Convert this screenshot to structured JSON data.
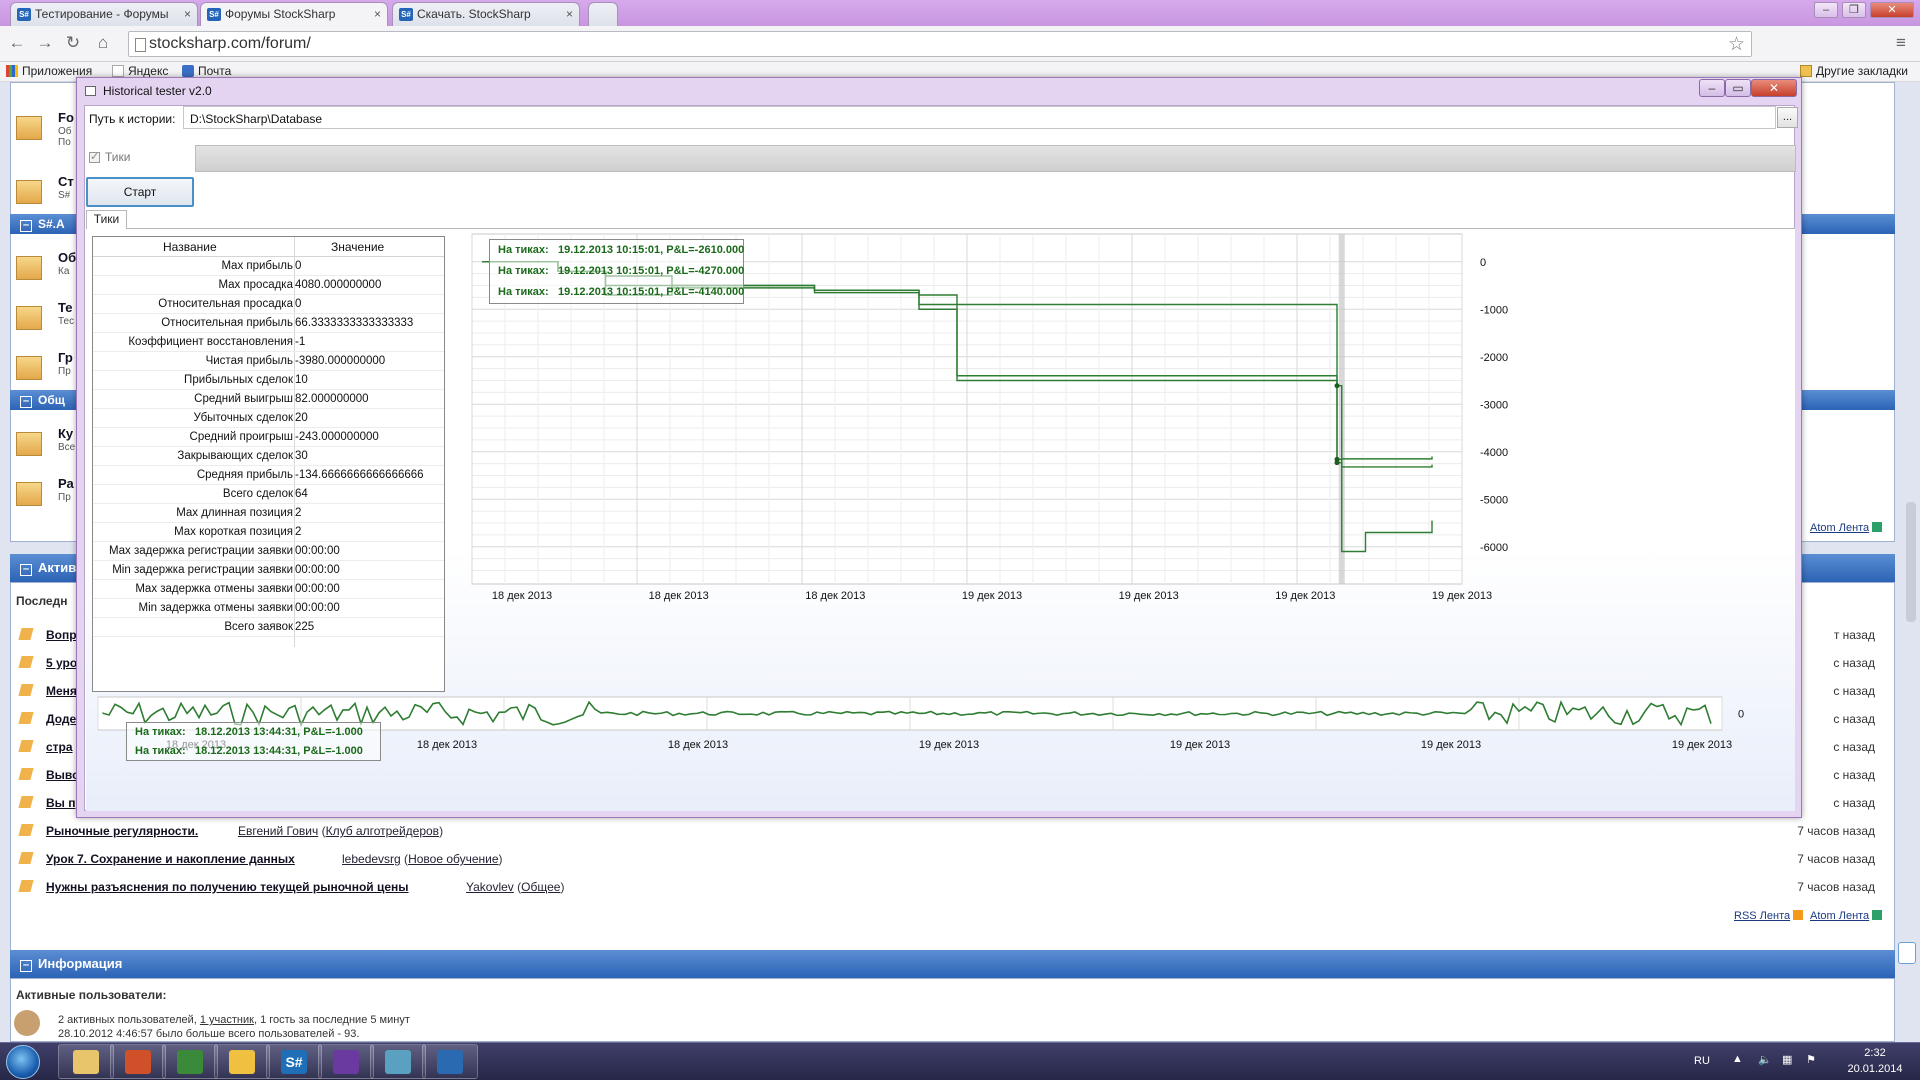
{
  "browser": {
    "tabs": [
      {
        "label": "Тестирование - Форумы"
      },
      {
        "label": "Форумы StockSharp"
      },
      {
        "label": "Скачать. StockSharp"
      }
    ],
    "tab_favicon": "S#",
    "url": "stocksharp.com/forum/",
    "bookmarks": {
      "apps": "Приложения",
      "yandex": "Яндекс",
      "mail": "Почта",
      "other": "Другие закладки"
    }
  },
  "webpage": {
    "left_items": [
      {
        "title": "Fo",
        "desc": "Об\nПо"
      },
      {
        "title": "Ст",
        "desc": "S#"
      },
      {
        "title": "Об",
        "desc": "Ка"
      },
      {
        "title": "Те",
        "desc": "Тес"
      },
      {
        "title": "Гр",
        "desc": "Пр"
      },
      {
        "title": "Ку",
        "desc": "Все"
      },
      {
        "title": "Ра",
        "desc": "Пр"
      }
    ],
    "section_sa": "S#.A",
    "section_general": "Общ",
    "section_active": "Актив",
    "recent_label": "Последн",
    "partial_rows": [
      "Вопр",
      "5 уро",
      "Меня",
      "Доде",
      "стра",
      "Выво",
      "Вы п"
    ],
    "rows": [
      {
        "title": "Рыночные регулярности.",
        "author": "Евгений Гович",
        "forum": "Клуб алготрейдеров",
        "time": "7 часов назад"
      },
      {
        "title": "Урок 7. Сохранение и накопление данных",
        "author": "lebedevsrg",
        "forum": "Новое обучение",
        "time": "7 часов назад"
      },
      {
        "title": "Нужны разъяснения по получению текущей рыночной цены",
        "author": "Yakovlev",
        "forum": "Общее",
        "time": "7 часов назад"
      }
    ],
    "right_times": [
      "т назад",
      "с назад",
      "с назад",
      "с назад",
      "с назад",
      "с назад",
      "с назад",
      "с назад"
    ],
    "rss_link": "RSS Лента",
    "atom_link": "Atom Лента",
    "info_header": "Информация",
    "active_users_label": "Активные пользователи:",
    "active_users_line1_a": "2 активных пользователей, ",
    "active_users_line1_link": "1 участник",
    "active_users_line1_b": ", 1 гость за последние 5 минут",
    "active_users_line2": "28.10.2012 4:46:57 было больше всего пользователей - 93."
  },
  "app": {
    "title": "Historical tester v2.0",
    "path_label": "Путь к истории:",
    "path_value": "D:\\StockSharp\\Database",
    "browse_label": "...",
    "ticks_checkbox": "Тики",
    "start_button": "Старт",
    "tab_label": "Тики",
    "grid_headers": {
      "name": "Название",
      "value": "Значение"
    },
    "stats": [
      {
        "name": "Max прибыль",
        "value": "0"
      },
      {
        "name": "Max просадка",
        "value": "4080.000000000"
      },
      {
        "name": "Относительная просадка",
        "value": "0"
      },
      {
        "name": "Относительная прибыль",
        "value": "66.3333333333333333"
      },
      {
        "name": "Коэффициент восстановления",
        "value": "-1"
      },
      {
        "name": "Чистая прибыль",
        "value": "-3980.000000000"
      },
      {
        "name": "Прибыльных сделок",
        "value": "10"
      },
      {
        "name": "Средний выигрыш",
        "value": "82.000000000"
      },
      {
        "name": "Убыточных сделок",
        "value": "20"
      },
      {
        "name": "Средний проигрыш",
        "value": "-243.000000000"
      },
      {
        "name": "Закрывающих сделок",
        "value": "30"
      },
      {
        "name": "Средняя прибыль",
        "value": "-134.6666666666666666"
      },
      {
        "name": "Всего сделок",
        "value": "64"
      },
      {
        "name": "Max длинная позиция",
        "value": "2"
      },
      {
        "name": "Max короткая позиция",
        "value": "2"
      },
      {
        "name": "Max задержка регистрации заявки",
        "value": "00:00:00"
      },
      {
        "name": "Min задержка регистрации заявки",
        "value": "00:00:00"
      },
      {
        "name": "Max задержка отмены заявки",
        "value": "00:00:00"
      },
      {
        "name": "Min задержка отмены заявки",
        "value": "00:00:00"
      },
      {
        "name": "Всего заявок",
        "value": "225"
      }
    ],
    "main_tooltip": [
      {
        "label": "На тиках:",
        "text": "19.12.2013 10:15:01, P&L=-2610.000"
      },
      {
        "label": "На тиках:",
        "text": "19.12.2013 10:15:01, P&L=-4270.000"
      },
      {
        "label": "На тиках:",
        "text": "19.12.2013 10:15:01, P&L=-4140.000"
      }
    ],
    "small_tooltip": [
      {
        "label": "На тиках:",
        "text": "18.12.2013 13:44:31, P&L=-1.000"
      },
      {
        "label": "На тиках:",
        "text": "18.12.2013 13:44:31, P&L=-1.000"
      }
    ]
  },
  "chart_data": [
    {
      "type": "line",
      "title": "",
      "xlabel": "",
      "ylabel": "",
      "x_ticks": [
        "18 дек 2013",
        "18 дек 2013",
        "18 дек 2013",
        "19 дек 2013",
        "19 дек 2013",
        "19 дек 2013",
        "19 дек 2013"
      ],
      "y_ticks": [
        "0",
        "-1000",
        "-2000",
        "-3000",
        "-4000",
        "-5000",
        "-6000"
      ],
      "ylim": [
        -6700,
        500
      ],
      "xlim": [
        0,
        10
      ],
      "grid": true,
      "line_color": "#2e7d32",
      "series": [
        {
          "values": [
            [
              0,
              0
            ],
            [
              0.8,
              -200
            ],
            [
              1.3,
              -300
            ],
            [
              2,
              -500
            ],
            [
              3.5,
              -600
            ],
            [
              4.6,
              -700
            ],
            [
              5,
              -900
            ],
            [
              9,
              -2610
            ],
            [
              9.05,
              -4150
            ],
            [
              10,
              -4100
            ]
          ]
        },
        {
          "values": [
            [
              0,
              0
            ],
            [
              0.8,
              -200
            ],
            [
              1.3,
              -700
            ],
            [
              2,
              -500
            ],
            [
              3.5,
              -600
            ],
            [
              4.6,
              -900
            ],
            [
              5,
              -2400
            ],
            [
              9,
              -4160
            ],
            [
              9.05,
              -4320
            ],
            [
              10,
              -4270
            ]
          ]
        },
        {
          "values": [
            [
              0,
              0
            ],
            [
              0.8,
              -200
            ],
            [
              1.3,
              -500
            ],
            [
              2,
              -550
            ],
            [
              3.5,
              -650
            ],
            [
              4.6,
              -1000
            ],
            [
              5,
              -2500
            ],
            [
              9,
              -4230
            ],
            [
              9.05,
              -6100
            ],
            [
              9.3,
              -5700
            ],
            [
              10,
              -5450
            ]
          ]
        }
      ]
    },
    {
      "type": "line",
      "title": "",
      "xlabel": "",
      "ylabel": "",
      "x_ticks": [
        "18 дек 2013",
        "18 дек 2013",
        "18 дек 2013",
        "19 дек 2013",
        "19 дек 2013",
        "19 дек 2013",
        "19 дек 2013"
      ],
      "y_ticks": [
        "0"
      ],
      "ylim": [
        -5,
        5
      ],
      "grid": true,
      "line_color": "#2e7d32"
    }
  ],
  "taskbar": {
    "lang": "RU",
    "time": "2:32",
    "date": "20.01.2014",
    "apps": [
      {
        "icon": "explorer-icon"
      },
      {
        "icon": "media-player-icon"
      },
      {
        "icon": "chrome-icon"
      },
      {
        "icon": "help-icon"
      },
      {
        "icon": "sharp-icon",
        "glyph": "S#"
      },
      {
        "icon": "visual-studio-icon"
      },
      {
        "icon": "paint-icon"
      },
      {
        "icon": "app-window-icon"
      }
    ]
  }
}
